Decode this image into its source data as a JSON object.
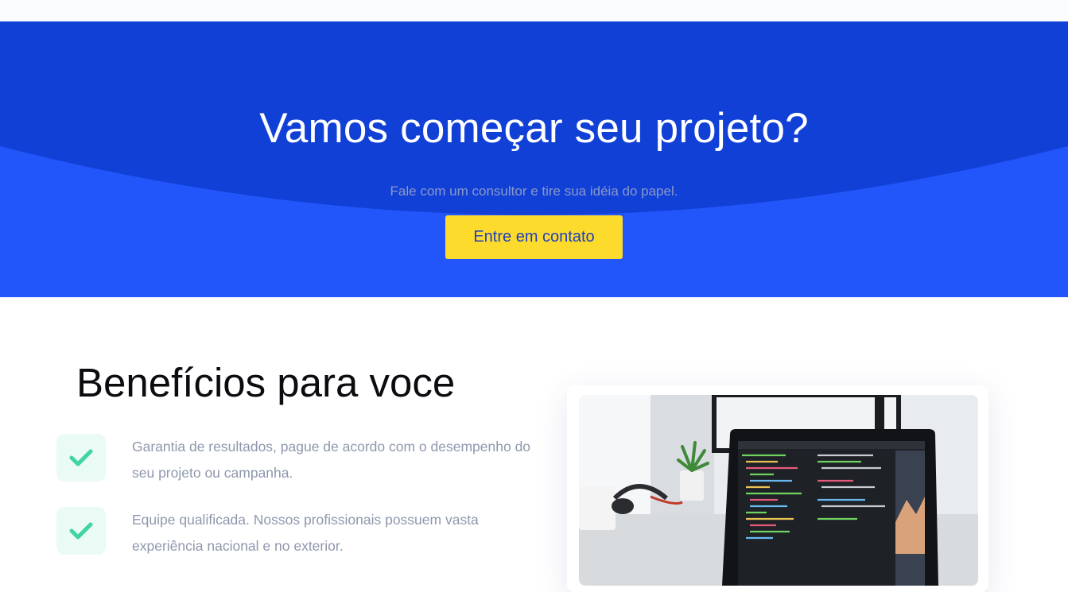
{
  "cta": {
    "title": "Vamos começar seu projeto?",
    "subtitle": "Fale com um consultor e tire sua idéia do papel.",
    "button_label": "Entre em contato"
  },
  "benefits": {
    "title": "Benefícios para voce",
    "items": [
      {
        "text": "Garantia de resultados, pague de acordo com o desempenho do seu projeto ou campanha.",
        "icon": "check-icon"
      },
      {
        "text": "Equipe qualificada. Nossos profissionais possuem vasta experiência nacional e no exterior.",
        "icon": "check-icon"
      }
    ],
    "image": {
      "icon": "laptop-code-photo"
    }
  },
  "colors": {
    "hero_dark": "#1140d6",
    "hero_light": "#2356fa",
    "button_bg": "#fddb2c",
    "button_text": "#1e3fc0",
    "check": "#3fd5a0",
    "check_bg": "#eafaf4"
  }
}
